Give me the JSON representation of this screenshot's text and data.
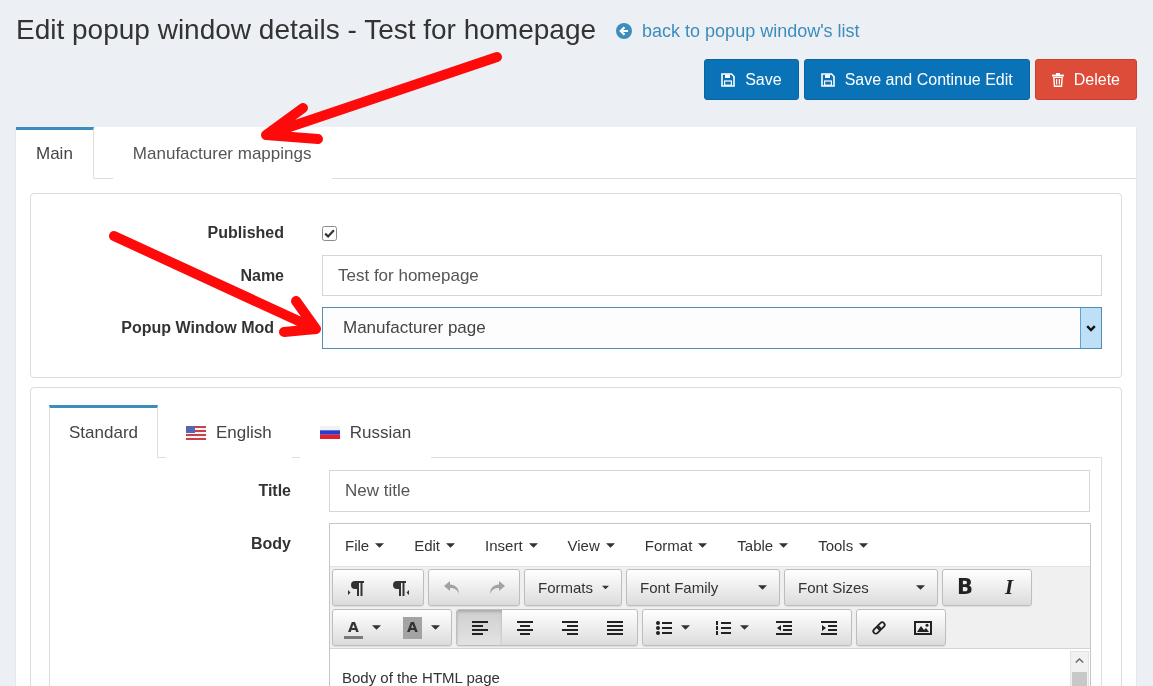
{
  "page": {
    "title": "Edit popup window details - Test for homepage",
    "back_link": "back to popup window's list"
  },
  "actions": [
    {
      "label": "Save",
      "kind": "save"
    },
    {
      "label": "Save and Continue Edit",
      "kind": "save"
    },
    {
      "label": "Delete",
      "kind": "delete"
    }
  ],
  "tabs": [
    {
      "label": "Main",
      "selected": true
    },
    {
      "label": "Manufacturer mappings",
      "selected": false
    }
  ],
  "main_form": [
    {
      "kind": "checkbox",
      "label": "Published",
      "checked": true
    },
    {
      "kind": "text",
      "label": "Name",
      "value": "Test for homepage"
    },
    {
      "kind": "select",
      "label": "Popup Window Mod",
      "value": "Manufacturer page",
      "focused": true
    }
  ],
  "locale_tabs": [
    {
      "label": "Standard",
      "kind": "plain",
      "selected": true
    },
    {
      "label": "English",
      "kind": "us",
      "selected": false
    },
    {
      "label": "Russian",
      "kind": "ru",
      "selected": false
    }
  ],
  "locale_form": {
    "title": {
      "label": "Title",
      "value": "New title"
    },
    "body": {
      "label": "Body"
    }
  },
  "editor": {
    "menu": [
      "File",
      "Edit",
      "Insert",
      "View",
      "Format",
      "Table",
      "Tools"
    ],
    "history_buttons": [
      {
        "disabled": true
      },
      {
        "disabled": true
      }
    ],
    "dropdowns": [
      "Formats",
      "Font Family",
      "Font Sizes"
    ],
    "style_buttons": [
      {
        "kind": "bold",
        "glyph": "B"
      },
      {
        "kind": "italic",
        "glyph": "I"
      }
    ],
    "color_buttons": [
      {
        "kind": "text",
        "glyph": "A"
      },
      {
        "kind": "background",
        "glyph": "A"
      }
    ],
    "align_buttons": [
      {
        "selected": true
      },
      {
        "selected": false
      },
      {
        "selected": false
      },
      {
        "selected": false
      }
    ],
    "content": "Body of the HTML page"
  }
}
